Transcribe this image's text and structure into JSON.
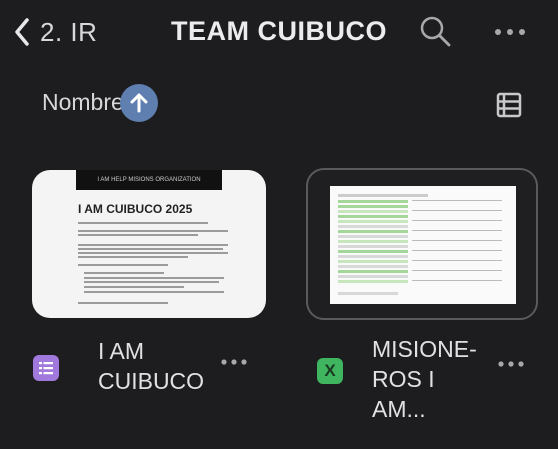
{
  "header": {
    "back_label": "2. IR",
    "title": "TEAM CUIBUCO"
  },
  "sort": {
    "label": "Nombre"
  },
  "files": [
    {
      "name_line1": "I AM",
      "name_line2": "CUIBUCO",
      "type_icon": "forms-icon",
      "preview": {
        "header_text": "I AM HELP  MISIONS ORGANIZATION",
        "title": "I AM CUIBUCO 2025"
      }
    },
    {
      "name_line1": "MISIONE-",
      "name_line2": "ROS I AM...",
      "type_icon": "sheets-icon",
      "icon_letter": "X"
    }
  ],
  "colors": {
    "background": "#1d1d1f",
    "sort_button": "#5f7fb0",
    "forms_icon": "#a179dd",
    "sheets_icon": "#3fb55f"
  }
}
